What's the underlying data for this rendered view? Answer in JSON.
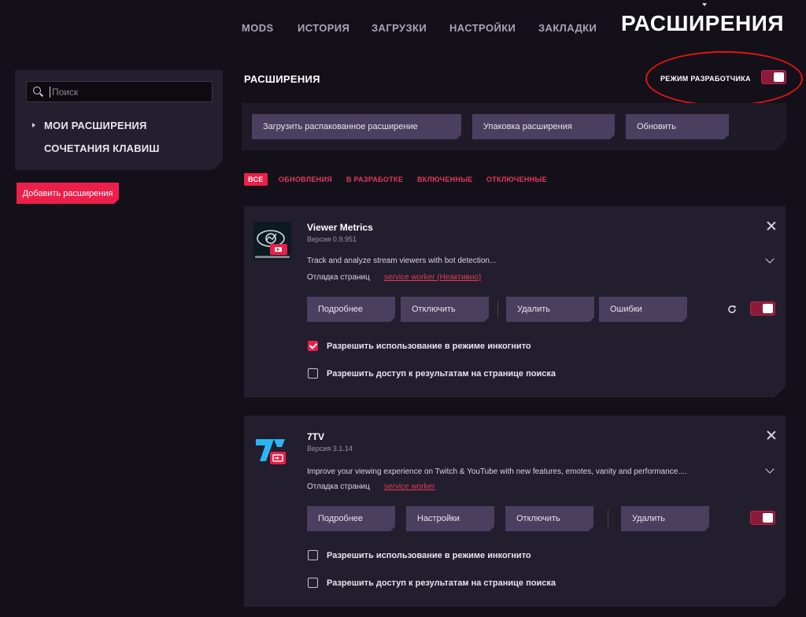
{
  "nav": {
    "items": [
      "MODS",
      "ИСТОРИЯ",
      "ЗАГРУЗКИ",
      "НАСТРОЙКИ",
      "ЗАКЛАДКИ"
    ],
    "title": "РАСШИРЕНИЯ"
  },
  "sidebar": {
    "search_placeholder": "Поиск",
    "items": [
      "МОИ РАСШИРЕНИЯ",
      "СОЧЕТАНИЯ КЛАВИШ"
    ],
    "add_button": "Добавить расширения"
  },
  "header": {
    "title": "РАСШИРЕНИЯ",
    "devmode_label": "РЕЖИМ РАЗРАБОТЧИКА",
    "devmode_on": true
  },
  "actions": {
    "load_unpacked": "Загрузить распакованное расширение",
    "pack": "Упаковка расширения",
    "update": "Обновить"
  },
  "filters": [
    "ВСЕ",
    "ОБНОВЛЕНИЯ",
    "В РАЗРАБОТКЕ",
    "ВКЛЮЧЕННЫЕ",
    "ОТКЛЮЧЕННЫЕ"
  ],
  "extensions": [
    {
      "name": "Viewer Metrics",
      "version": "Версия 0.9.951",
      "description": "Track and analyze stream viewers with bot detection...",
      "inspect_label": "Отладка страниц",
      "inspect_link": "service worker (Неактивно)",
      "buttons": [
        "Подробнее",
        "Отключить",
        "Удалить",
        "Ошибки"
      ],
      "enabled": true,
      "checkboxes": [
        {
          "label": "Разрешить использование в режиме инкогнито",
          "checked": true
        },
        {
          "label": "Разрешить доступ к результатам на странице поиска",
          "checked": false
        }
      ],
      "icon": "viewer-metrics-logo-icon"
    },
    {
      "name": "7TV",
      "version": "Версия 3.1.14",
      "description": "Improve your viewing experience on Twitch & YouTube with new features, emotes, vanity and performance....",
      "inspect_label": "Отладка страниц",
      "inspect_link": "service worker",
      "buttons": [
        "Подробнее",
        "Настройки",
        "Отключить",
        "Удалить"
      ],
      "enabled": true,
      "checkboxes": [
        {
          "label": "Разрешить использование в режиме инкогнито",
          "checked": false
        },
        {
          "label": "Разрешить доступ к результатам на странице поиска",
          "checked": false
        }
      ],
      "icon": "7tv-logo-icon"
    }
  ],
  "colors": {
    "accent": "#ec1f4a",
    "background": "#141019",
    "card": "#231e2d",
    "button": "#4a3f5e",
    "annotation": "#e01414"
  }
}
